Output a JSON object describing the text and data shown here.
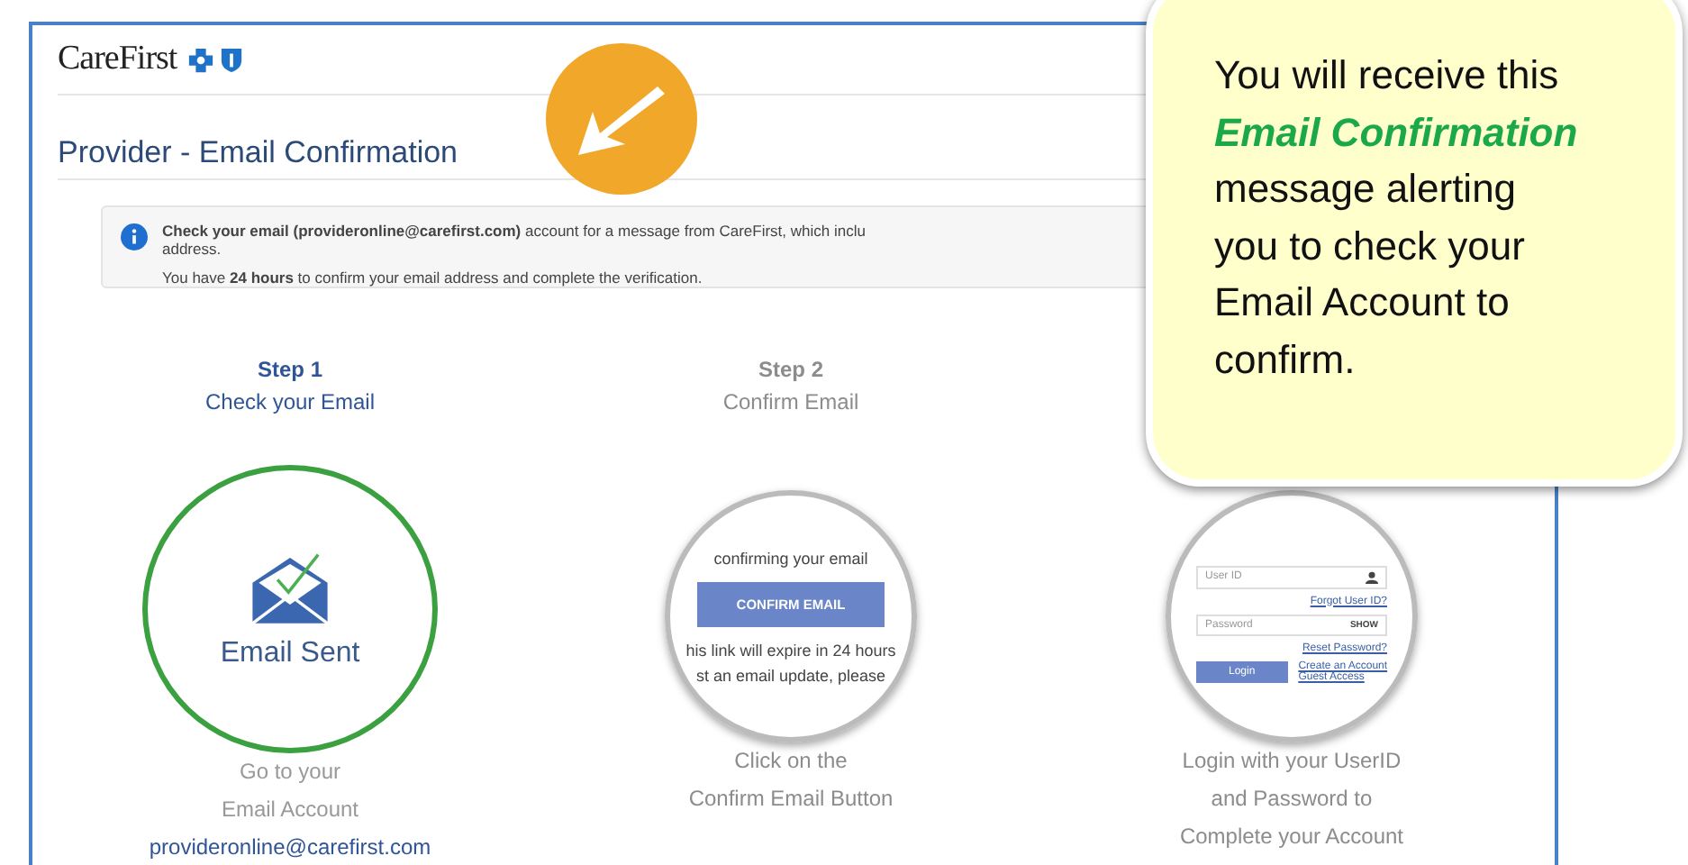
{
  "header": {
    "logo": "CareFirst"
  },
  "page_title": "Provider - Email Confirmation",
  "notice": {
    "lines": [
      "**Check your email (provideronline@carefirst.com)** account for a message from CareFirst, which inclu",
      "address.",
      "You have **24 hours** to confirm your email address and complete the verification."
    ]
  },
  "steps": [
    {
      "kind": "sent",
      "active": true,
      "title": "Step 1",
      "subtitle": "Check your Email",
      "circle_label": "Email Sent",
      "lines": [
        "Go to your",
        "Email Account"
      ],
      "link": "provideronline@carefirst.com"
    },
    {
      "kind": "confirm",
      "active": false,
      "title": "Step 2",
      "subtitle": "Confirm Email",
      "mini": {
        "intro": "confirming your email",
        "button": "CONFIRM EMAIL",
        "notes": [
          "his link will expire in 24 hours",
          "st an email update, please"
        ]
      },
      "lines": [
        "Click on the",
        "Confirm Email Button"
      ]
    },
    {
      "kind": "login",
      "active": false,
      "mini": {
        "user_placeholder": "User ID",
        "forgot": "Forgot User ID?",
        "password_placeholder": "Password",
        "show": "SHOW",
        "reset": "Reset Password?",
        "login": "Login",
        "create": "Create an Account",
        "guest": "Guest Access"
      },
      "lines": [
        "Login with your UserID",
        "and Password to",
        "Complete your Account"
      ]
    }
  ],
  "callout": {
    "before": "You will receive this",
    "highlight": "Email Confirmation",
    "after": "message alerting you to check your Email Account to confirm."
  }
}
